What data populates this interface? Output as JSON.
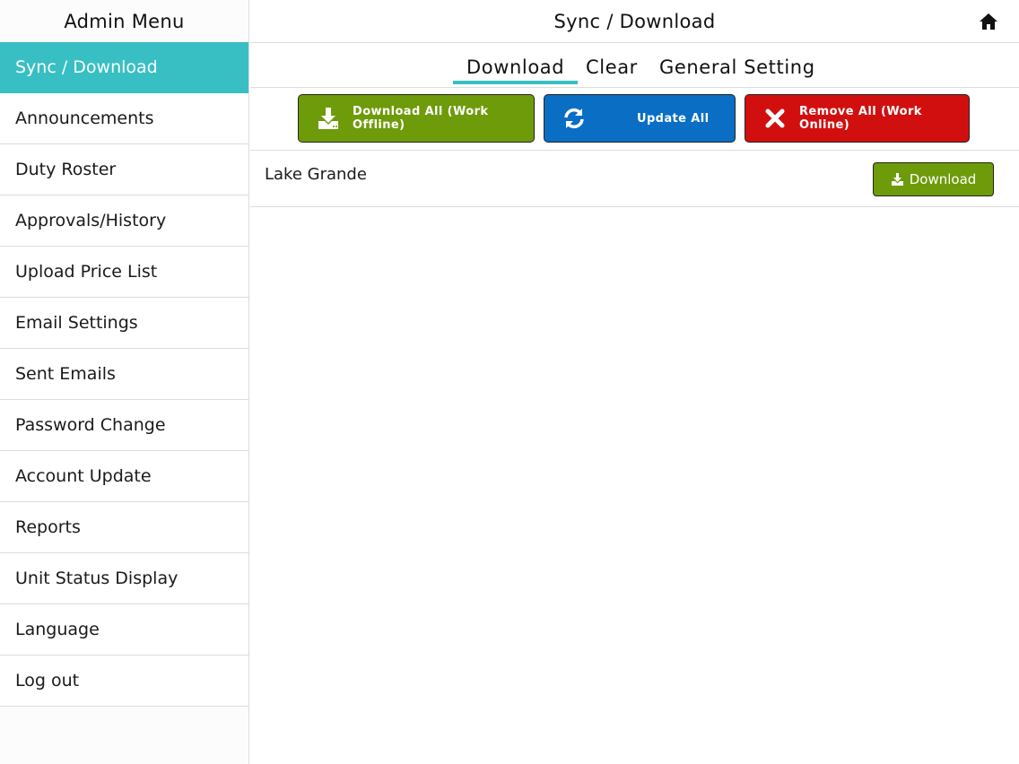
{
  "sidebar": {
    "title": "Admin Menu",
    "items": [
      {
        "label": "Sync / Download",
        "active": true
      },
      {
        "label": "Announcements"
      },
      {
        "label": "Duty Roster"
      },
      {
        "label": "Approvals/History"
      },
      {
        "label": "Upload Price List"
      },
      {
        "label": "Email Settings"
      },
      {
        "label": "Sent Emails"
      },
      {
        "label": "Password Change"
      },
      {
        "label": "Account Update"
      },
      {
        "label": "Reports"
      },
      {
        "label": "Unit Status Display"
      },
      {
        "label": "Language"
      },
      {
        "label": "Log out"
      }
    ]
  },
  "header": {
    "title": "Sync / Download",
    "home_icon": "home-icon"
  },
  "tabs": [
    {
      "label": "Download",
      "active": true
    },
    {
      "label": "Clear"
    },
    {
      "label": "General Setting"
    }
  ],
  "actions": {
    "download_all": {
      "label": "Download All (Work Offline)",
      "icon": "download-icon",
      "color": "#6e9b0a"
    },
    "update_all": {
      "label": "Update All",
      "icon": "refresh-icon",
      "color": "#0a6ec4"
    },
    "remove_all": {
      "label": "Remove All (Work Online)",
      "icon": "close-icon",
      "color": "#d20f0f"
    }
  },
  "items": [
    {
      "name": "Lake Grande",
      "button_label": "Download"
    }
  ],
  "colors": {
    "accent": "#38bfc3",
    "green": "#6e9b0a",
    "blue": "#0a6ec4",
    "red": "#d20f0f"
  }
}
